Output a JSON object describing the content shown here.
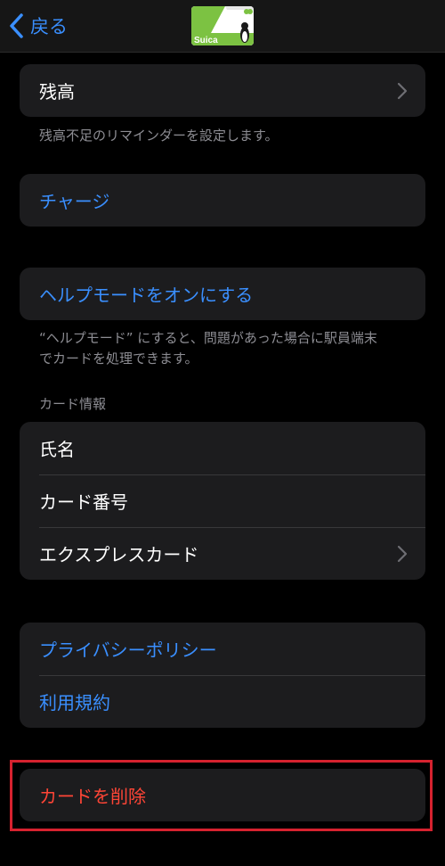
{
  "nav": {
    "back_label": "戻る",
    "card_logo_text": "Suica"
  },
  "balance": {
    "label": "残高",
    "footer": "残高不足のリマインダーを設定します。"
  },
  "charge": {
    "label": "チャージ"
  },
  "help_mode": {
    "label": "ヘルプモードをオンにする",
    "footer_line1": "“ヘルプモード” にすると、問題があった場合に駅員端末",
    "footer_line2": "でカードを処理できます。"
  },
  "card_info": {
    "header": "カード情報",
    "rows": [
      {
        "label": "氏名"
      },
      {
        "label": "カード番号"
      },
      {
        "label": "エクスプレスカード"
      }
    ]
  },
  "legal": {
    "rows": [
      {
        "label": "プライバシーポリシー"
      },
      {
        "label": "利用規約"
      }
    ]
  },
  "remove": {
    "label": "カードを削除"
  },
  "colors": {
    "background": "#000000",
    "cell": "#1c1c1e",
    "link": "#3a8fff",
    "destructive": "#ff4536",
    "secondary_text": "#8d8d93",
    "highlight_border": "#d6222f",
    "card_green": "#7cc242"
  }
}
